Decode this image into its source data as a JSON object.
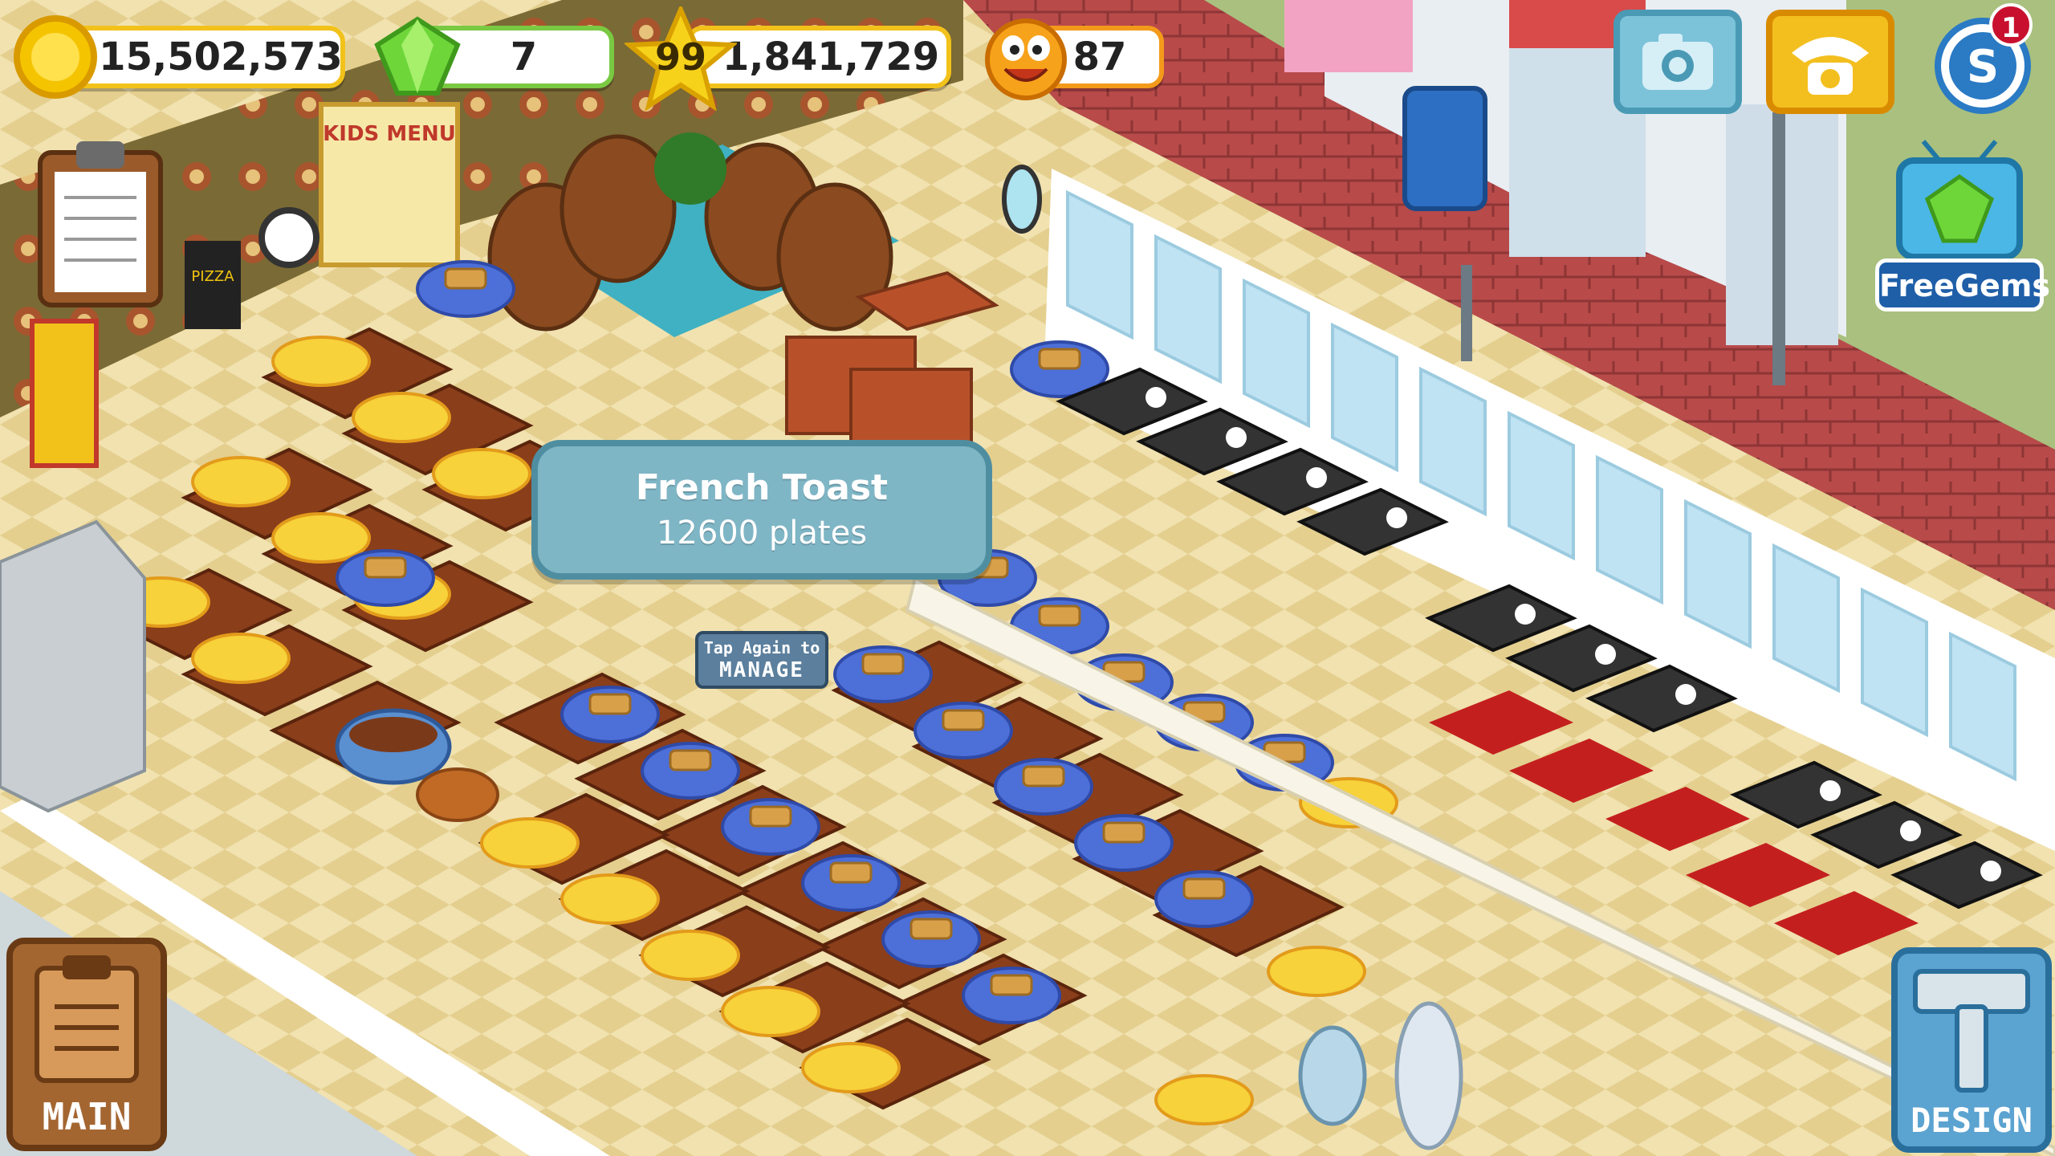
{
  "hud": {
    "coins": "15,502,573",
    "gems": "7",
    "level": "99",
    "xp": "1,841,729",
    "happiness": "87"
  },
  "topbar": {
    "camera_icon": "camera-icon",
    "phone_icon": "phone-icon",
    "social_badge": "1",
    "free_gems_label": "FreeGems"
  },
  "tooltip": {
    "dish_name": "French Toast",
    "plates": "12600 plates"
  },
  "manage": {
    "line1": "Tap Again to",
    "line2": "MANAGE"
  },
  "buttons": {
    "main_label": "MAIN",
    "design_label": "DESIGN"
  },
  "decor": {
    "pizza_sign": "PIZZA",
    "menu_sign": "KIDS MENU"
  },
  "colors": {
    "gold_border": "#f2c21b",
    "green_border": "#7ac943",
    "orange_border": "#f39a1b",
    "tooltip_bg": "#7fb6c6",
    "red_brick": "#b84a4a"
  }
}
